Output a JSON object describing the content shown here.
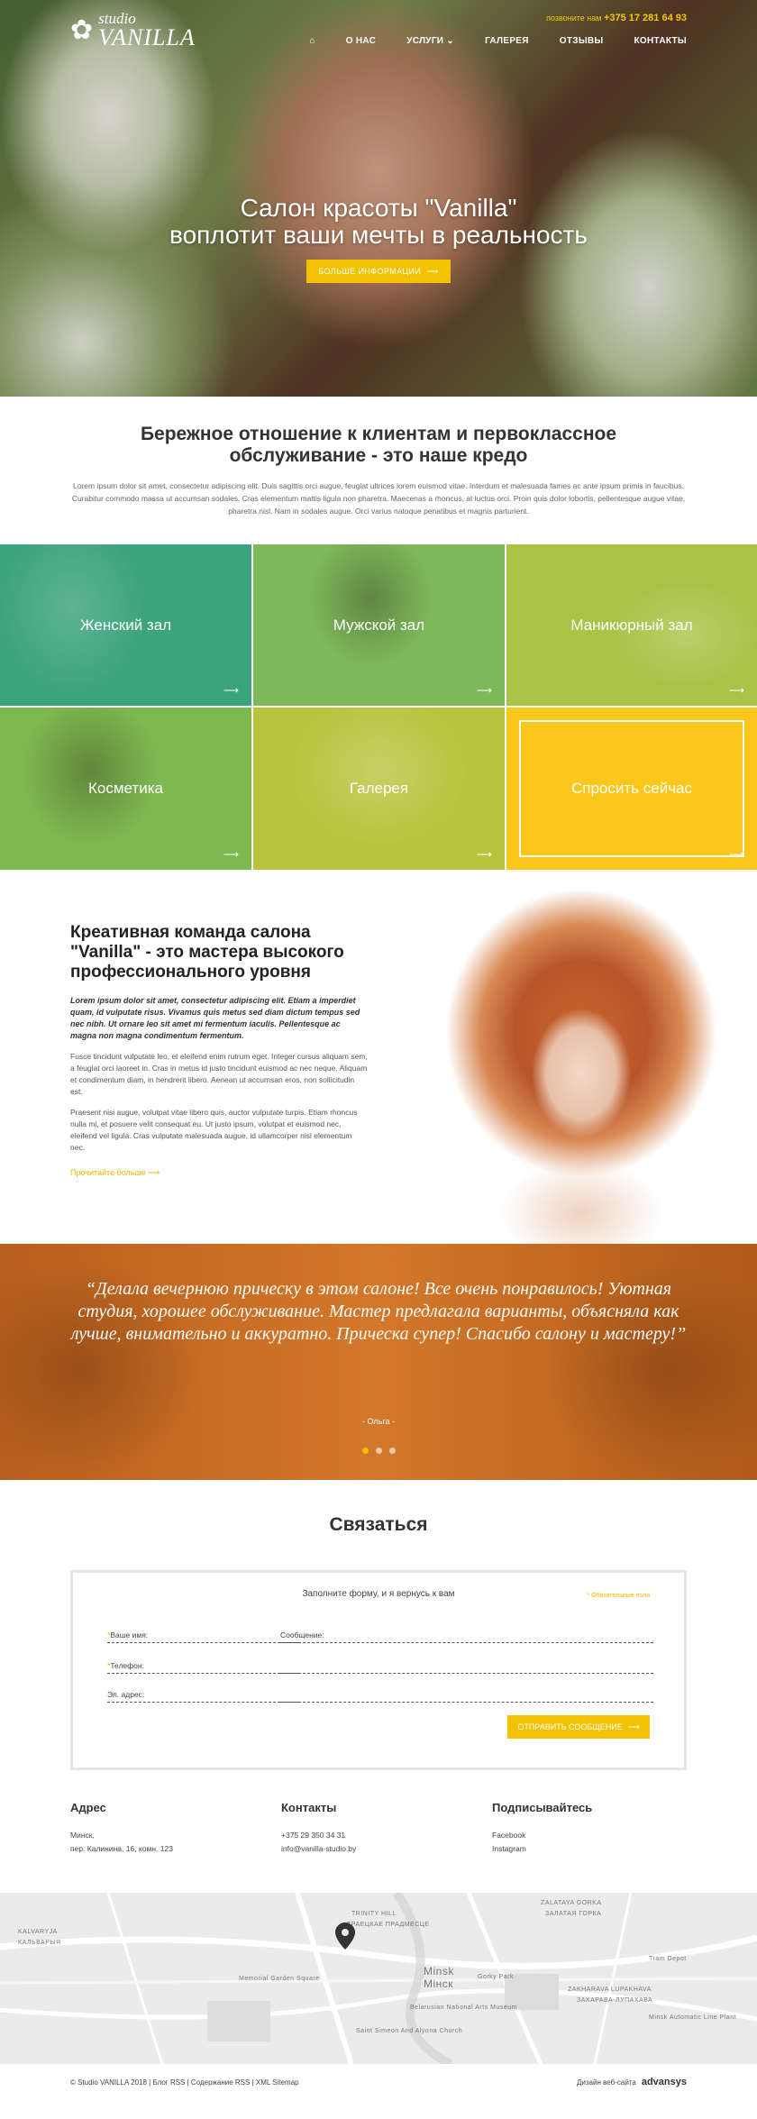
{
  "header": {
    "logo_top": "studio",
    "logo_bottom": "VANILLA",
    "phone_label": "позвоните нам",
    "phone": "+375 17 281 64 93",
    "nav": [
      "О НАС",
      "УСЛУГИ",
      "ГАЛЕРЕЯ",
      "ОТЗЫВЫ",
      "КОНТАКТЫ"
    ]
  },
  "hero": {
    "title_line1": "Салон красоты \"Vanilla\"",
    "title_line2": "воплотит ваши мечты в реальность",
    "button": "БОЛЬШЕ ИНФОРМАЦИИ"
  },
  "credo": {
    "title": "Бережное отношение к клиентам и первоклассное обслуживание - это наше кредо",
    "text": "Lorem ipsum dolor sit amet, consectetur adipiscing elit. Duis sagittis orci augue, feugiat ultrices lorem euismod vitae. Interdum et malesuada fames ac ante ipsum primis in faucibus. Curabitur commodo massa ut accumsan sodales. Cras elementum mattis ligula non pharetra. Maecenas a rhoncus, at luctus orci. Proin quis dolor lobortis, pellentesque augue vitae, pharetra nisl. Nam in sodales augue. Orci varius natoque penatibus et magnis parturient."
  },
  "tiles": [
    "Женский зал",
    "Мужской зал",
    "Маникюрный зал",
    "Косметика",
    "Галерея",
    "Спросить сейчас"
  ],
  "team": {
    "title": "Креативная команда салона \"Vanilla\" - это мастера высокого профессионального уровня",
    "lead": "Lorem ipsum dolor sit amet, consectetur adipiscing elit. Etiam a imperdiet quam, id vulputate risus. Vivamus quis metus sed diam dictum tempus sed nec nibh. Ut ornare leo sit amet mi fermentum iaculis. Pellentesque ac magna non magna condimentum fermentum.",
    "para1": "Fusce tincidunt vulputate leo, et eleifend enim rutrum eget. Integer cursus aliquam sem, a feugiat orci laoreet in. Cras in metus id justo tincidunt euismod ac nec neque. Aliquam et condimentum diam, in hendrerit libero. Aenean ut accumsan eros, non sollicitudin est.",
    "para2": "Praesent nisi augue, volutpat vitae libero quis, auctor vulputate turpis. Etiam rhoncus nulla mi, et posuere velit consequat eu. Ut justo ipsum, volutpat et euismod nec, eleifend vel ligula. Cras vulputate malesuada augue, id ullamcorper nisl elementum nec.",
    "more": "Прочитайте больше"
  },
  "testimonial": {
    "quote": "“Делала вечернюю прическу в этом салоне! Все очень понравилось! Уютная студия, хорошее обслуживание. Мастер предлагала варианты, объясняла как лучше, внимательно и аккуратно. Прическа супер! Спасибо салону и мастеру!”",
    "author": "- Ольга -"
  },
  "contact": {
    "title": "Связаться",
    "form_title": "Заполните форму, и я вернусь к вам",
    "required_note": "* Обязательные поля",
    "name_label": "Ваше имя:",
    "phone_label": "Телефон:",
    "email_label": "Эл. адрес:",
    "message_label": "Сообщение:",
    "submit": "ОТПРАВИТЬ СООБЩЕНИЕ"
  },
  "footer": {
    "address_title": "Адрес",
    "address_line1": "Минск,",
    "address_line2": "пер. Калинина, 16, комн. 123",
    "contacts_title": "Контакты",
    "contacts_phone": "+375 29 350 34 31",
    "contacts_email": "info@vanilla-studio.by",
    "subscribe_title": "Подписывайтесь",
    "facebook": "Facebook",
    "instagram": "Instagram"
  },
  "map": {
    "labels": [
      "KALVARYJA",
      "КАЛЬВАРЫЯ",
      "TRINITY HILL",
      "ТРАЕЦКАЕ ПРАДМЕСЦЕ",
      "ZALATAYA GORKA",
      "ЗАЛАТАЯ ГОРКА",
      "Minsk",
      "Мінск",
      "ZAKHARAVA LUPAKHAVA",
      "ЗАХАРАВА-ЛУПАХАВА",
      "Memorial Garden Square",
      "Gorky Park",
      "Tram Depot",
      "Belarusian National Arts Museum",
      "Saint Simeon And Alyona Church",
      "Minsk Automatic Line Plant"
    ]
  },
  "bottom": {
    "copyright": "© Studio VANILLA 2018  |  Блог RSS | Содержание RSS | XML Sitemap",
    "design_label": "Дизайн веб-сайта",
    "design_brand": "advansys"
  },
  "colors": {
    "accent": "#f2c200",
    "green": "#3ba37d",
    "orange": "#c86b22"
  }
}
